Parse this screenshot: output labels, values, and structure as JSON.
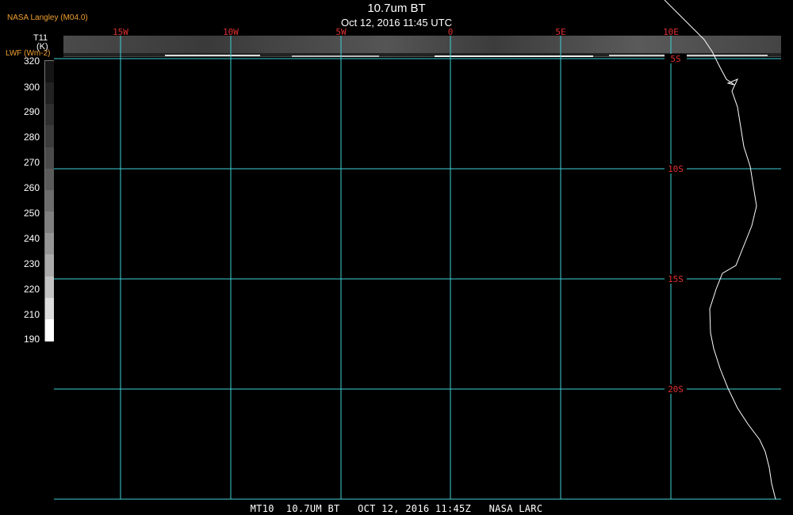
{
  "header": {
    "title": "10.7um BT",
    "subtitle": "Oct 12, 2016 11:45 UTC",
    "credit": "NASA Langley (M04.0)"
  },
  "legend": {
    "variable": "T11",
    "unit": "(K)",
    "alt_label": "LWF (Wm-2)",
    "ticks": [
      "320",
      "300",
      "290",
      "280",
      "270",
      "260",
      "250",
      "240",
      "230",
      "220",
      "210",
      "190"
    ],
    "colors": [
      "#151515",
      "#222222",
      "#2f2f2f",
      "#3c3c3c",
      "#4b4b4b",
      "#5b5b5b",
      "#6d6d6d",
      "#808080",
      "#959595",
      "#ababab",
      "#c3c3c3",
      "#dddddd",
      "#ffffff"
    ]
  },
  "map": {
    "lon_labels": [
      "15W",
      "10W",
      "5W",
      "0",
      "5E",
      "10E"
    ],
    "lat_labels": [
      "5S",
      "10S",
      "15S",
      "20S"
    ],
    "grid_color": "#3fd0d8",
    "label_color": "#e03030",
    "coast_color": "#ffffff"
  },
  "footer": {
    "text": "MT10  10.7UM BT   OCT 12, 2016 11:45Z   NASA LARC"
  }
}
